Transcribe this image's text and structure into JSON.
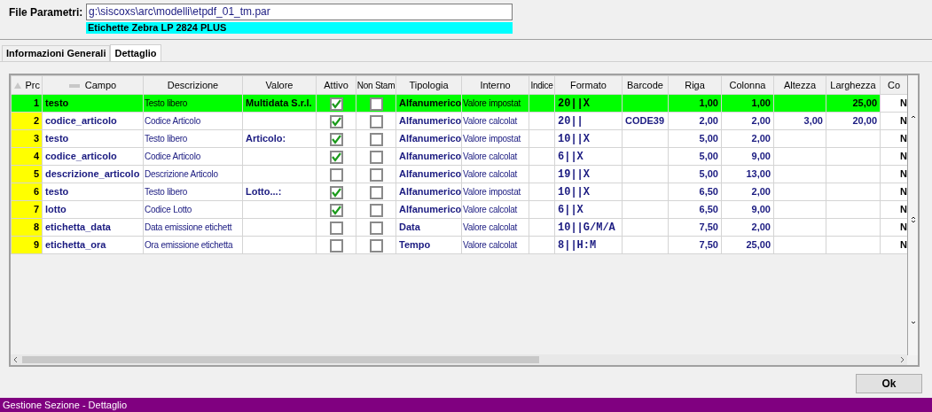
{
  "header": {
    "file_label": "File Parametri:",
    "file_value": "g:\\siscoxs\\arc\\modelli\\etpdf_01_tm.par",
    "printer": "Etichette Zebra LP 2824 PLUS"
  },
  "tabs": [
    {
      "label": "Informazioni Generali",
      "selected": false
    },
    {
      "label": "Dettaglio",
      "selected": true
    }
  ],
  "table": {
    "columns": [
      "Prc",
      "Campo",
      "Descrizione",
      "Valore",
      "Attivo",
      "Non Stam",
      "Tipologia",
      "Interno",
      "Indice",
      "Formato",
      "Barcode",
      "Riga",
      "Colonna",
      "Altezza",
      "Larghezza",
      "Co"
    ],
    "rows": [
      {
        "selected": true,
        "prc": "1",
        "campo": "testo",
        "descrizione": "Testo libero",
        "valore": "Multidata S.r.l.",
        "attivo": true,
        "non_stampabile": false,
        "tipologia": "Alfanumerico",
        "interno": "Valore impostat",
        "formato": "20||X",
        "barcode": "",
        "riga": "1,00",
        "colonna": "1,00",
        "altezza": "",
        "larghezza": "25,00",
        "column_16": "N"
      },
      {
        "selected": false,
        "prc": "2",
        "campo": "codice_articolo",
        "descrizione": "Codice Articolo",
        "valore": "",
        "attivo": true,
        "non_stampabile": false,
        "tipologia": "Alfanumerico",
        "interno": "Valore calcolat",
        "formato": "20||",
        "barcode": "CODE39",
        "riga": "2,00",
        "colonna": "2,00",
        "altezza": "3,00",
        "larghezza": "20,00",
        "column_16": "N"
      },
      {
        "selected": false,
        "prc": "3",
        "campo": "testo",
        "descrizione": "Testo libero",
        "valore": "Articolo:",
        "attivo": true,
        "non_stampabile": false,
        "tipologia": "Alfanumerico",
        "interno": "Valore impostat",
        "formato": "10||X",
        "barcode": "",
        "riga": "5,00",
        "colonna": "2,00",
        "altezza": "",
        "larghezza": "",
        "column_16": "N"
      },
      {
        "selected": false,
        "prc": "4",
        "campo": "codice_articolo",
        "descrizione": "Codice Articolo",
        "valore": "",
        "attivo": true,
        "non_stampabile": false,
        "tipologia": "Alfanumerico",
        "interno": "Valore calcolat",
        "formato": "6||X",
        "barcode": "",
        "riga": "5,00",
        "colonna": "9,00",
        "altezza": "",
        "larghezza": "",
        "column_16": "N"
      },
      {
        "selected": false,
        "prc": "5",
        "campo": "descrizione_articolo",
        "descrizione": "Descrizione Articolo",
        "valore": "",
        "attivo": false,
        "non_stampabile": false,
        "tipologia": "Alfanumerico",
        "interno": "Valore calcolat",
        "formato": "19||X",
        "barcode": "",
        "riga": "5,00",
        "colonna": "13,00",
        "altezza": "",
        "larghezza": "",
        "column_16": "N"
      },
      {
        "selected": false,
        "prc": "6",
        "campo": "testo",
        "descrizione": "Testo libero",
        "valore": "Lotto...:",
        "attivo": true,
        "non_stampabile": false,
        "tipologia": "Alfanumerico",
        "interno": "Valore impostat",
        "formato": "10||X",
        "barcode": "",
        "riga": "6,50",
        "colonna": "2,00",
        "altezza": "",
        "larghezza": "",
        "column_16": "N"
      },
      {
        "selected": false,
        "prc": "7",
        "campo": "lotto",
        "descrizione": "Codice Lotto",
        "valore": "",
        "attivo": true,
        "non_stampabile": false,
        "tipologia": "Alfanumerico",
        "interno": "Valore calcolat",
        "formato": "6||X",
        "barcode": "",
        "riga": "6,50",
        "colonna": "9,00",
        "altezza": "",
        "larghezza": "",
        "column_16": "N"
      },
      {
        "selected": false,
        "prc": "8",
        "campo": "etichetta_data",
        "descrizione": "Data emissione etichett",
        "valore": "",
        "attivo": false,
        "non_stampabile": false,
        "tipologia": "Data",
        "interno": "Valore calcolat",
        "formato": "10||G/M/A",
        "barcode": "",
        "riga": "7,50",
        "colonna": "2,00",
        "altezza": "",
        "larghezza": "",
        "column_16": "N"
      },
      {
        "selected": false,
        "prc": "9",
        "campo": "etichetta_ora",
        "descrizione": "Ora emissione etichetta",
        "valore": "",
        "attivo": false,
        "non_stampabile": false,
        "tipologia": "Tempo",
        "interno": "Valore calcolat",
        "formato": "8||H:M",
        "barcode": "",
        "riga": "7,50",
        "colonna": "25,00",
        "altezza": "",
        "larghezza": "",
        "column_16": "N"
      }
    ]
  },
  "ok_button": "Ok",
  "status_bar": "Gestione Sezione - Dettaglio"
}
